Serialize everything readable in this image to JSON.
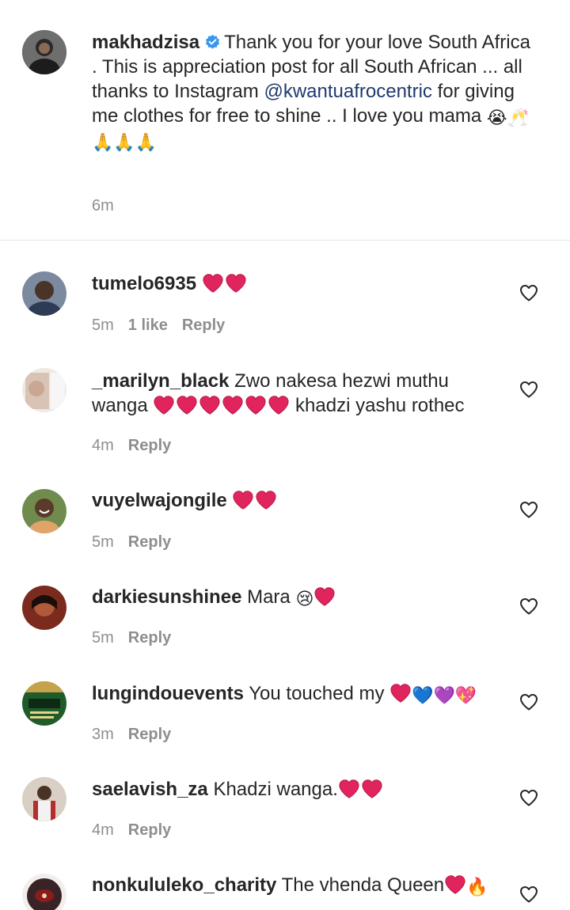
{
  "caption": {
    "username": "makhadzisa",
    "text_1": "Thank you for your love South Africa . This is appreciation post for all South African ... all thanks to Instagram ",
    "mention": "@kwantuafrocentric",
    "text_2": " for giving me clothes for free to shine .. I love you mama ",
    "emojis_end": "😭🥂",
    "emojis_line2": "🙏🙏🙏",
    "time": "6m"
  },
  "comments": [
    {
      "username": "tumelo6935",
      "text_before": "",
      "text_after": "",
      "time": "5m",
      "likes": "1 like",
      "reply": "Reply"
    },
    {
      "username": "_marilyn_black",
      "text_before": "Zwo nakesa hezwi muthu wanga ",
      "text_after": " khadzi yashu rothec",
      "time": "4m",
      "reply": "Reply"
    },
    {
      "username": "vuyelwajongile",
      "text_before": "",
      "text_after": "",
      "time": "5m",
      "reply": "Reply"
    },
    {
      "username": "darkiesunshinee",
      "text_before": "Mara ",
      "emoji": "😢",
      "text_after": "",
      "time": "5m",
      "reply": "Reply"
    },
    {
      "username": "lungindouevents",
      "text_before": "You touched my ",
      "emoji_tail": "💙💜💖",
      "text_after": "",
      "time": "3m",
      "reply": "Reply"
    },
    {
      "username": "saelavish_za",
      "text_before": "Khadzi wanga.",
      "text_after": "",
      "time": "4m",
      "reply": "Reply"
    },
    {
      "username": "nonkululeko_charity",
      "text_before": "The vhenda Queen",
      "emoji_tail": "🔥",
      "text_after": ""
    }
  ],
  "icons": {
    "like": "heart-outline-icon",
    "verified": "verified-badge-icon",
    "red_heart": "red-heart-emoji"
  },
  "colors": {
    "text": "#262626",
    "muted": "#8e8e8e",
    "link": "#1e3a6e",
    "verified": "#3897f0",
    "heart": "#e0245e"
  }
}
